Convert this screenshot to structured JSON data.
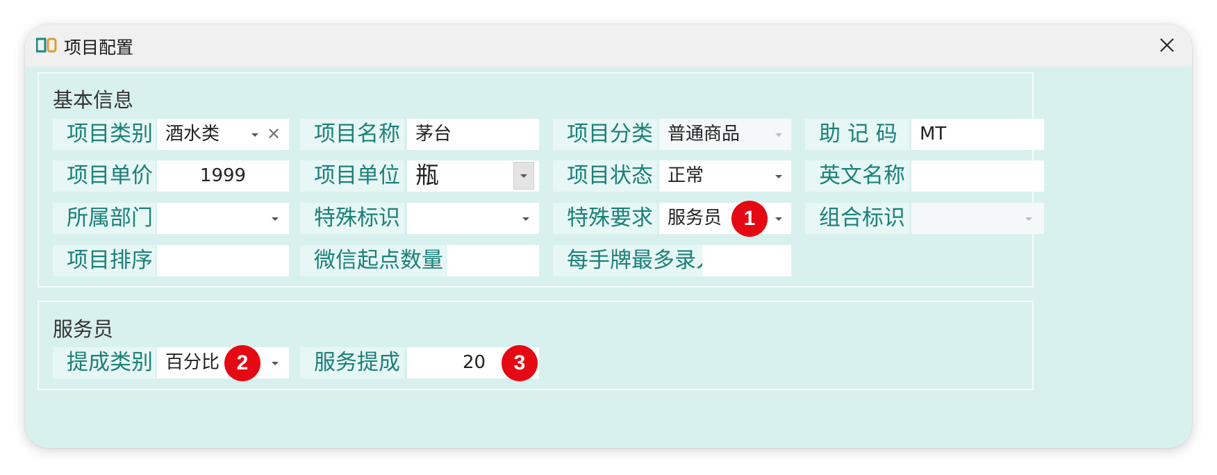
{
  "window": {
    "title": "项目配置",
    "icon": "app-logo-icon",
    "close_icon": "close-icon"
  },
  "basic": {
    "title": "基本信息",
    "category_label": "项目类别",
    "category_value": "酒水类",
    "name_label": "项目名称",
    "name_value": "茅台",
    "class_label": "项目分类",
    "class_value": "普通商品",
    "mnemonic_label": "助 记 码",
    "mnemonic_value": "MT",
    "price_label": "项目单价",
    "price_value": "1999",
    "unit_label": "项目单位",
    "unit_value": "瓶",
    "status_label": "项目状态",
    "status_value": "正常",
    "english_label": "英文名称",
    "english_value": "",
    "dept_label": "所属部门",
    "dept_value": "",
    "special_mark_label": "特殊标识",
    "special_mark_value": "",
    "special_req_label": "特殊要求",
    "special_req_value": "服务员",
    "combo_label": "组合标识",
    "combo_value": "",
    "sort_label": "项目排序",
    "sort_value": "",
    "wechat_label": "微信起点数量",
    "wechat_value": "",
    "max_label": "每手牌最多录入",
    "max_value": ""
  },
  "service": {
    "title": "服务员",
    "commission_type_label": "提成类别",
    "commission_type_value": "百分比",
    "commission_label": "服务提成",
    "commission_value": "20"
  },
  "badges": [
    "1",
    "2",
    "3"
  ],
  "colors": {
    "label_text": "#1b8079",
    "panel_bg": "#d9f1ee",
    "badge": "#e50914"
  }
}
